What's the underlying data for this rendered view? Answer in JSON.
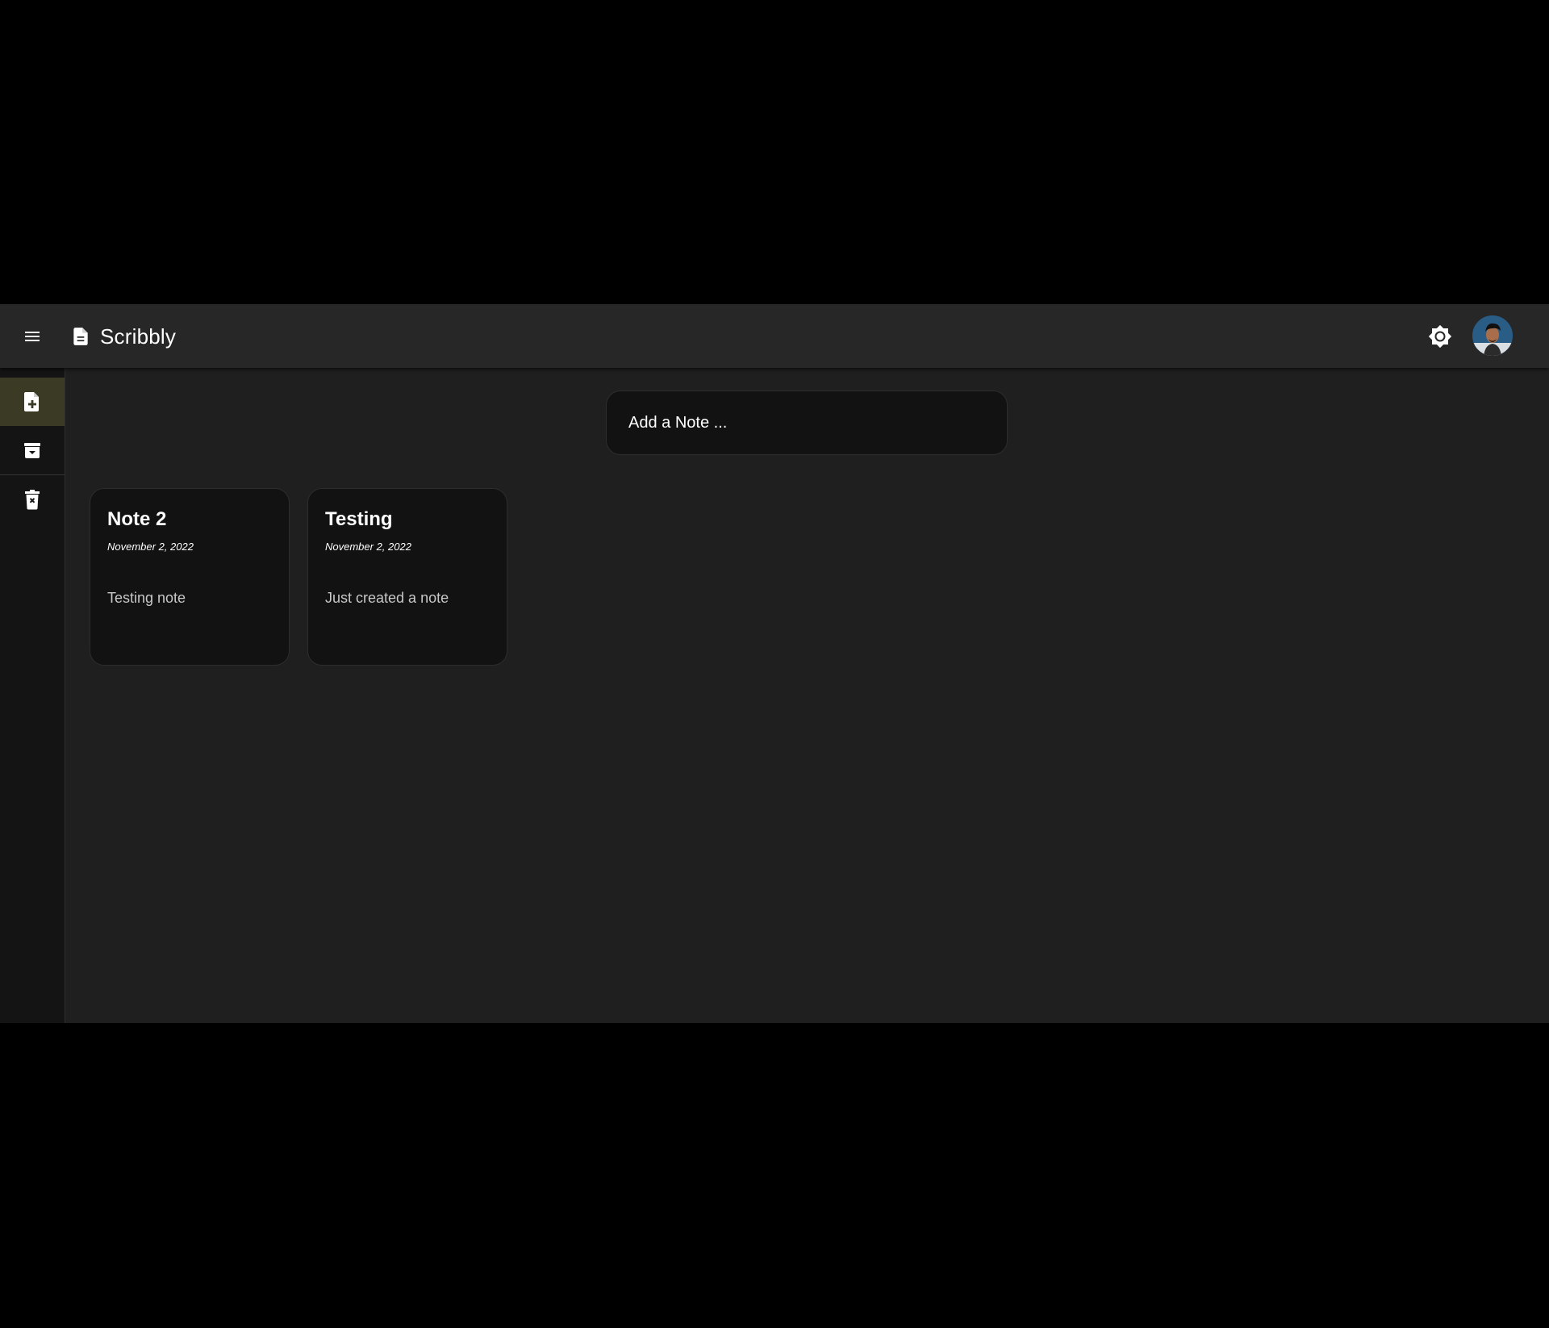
{
  "app": {
    "title": "Scribbly",
    "theme": "dark",
    "colors": {
      "background": "#1f1f1f",
      "appbar": "#272727",
      "sidebar": "#141414",
      "sidebar_active": "#3b3a25",
      "card": "#121212",
      "text": "#ffffff",
      "muted_text": "#c8c8c8"
    }
  },
  "header": {
    "menu_icon": "menu-icon",
    "brand_icon": "document-icon",
    "theme_toggle_icon": "brightness-icon",
    "avatar_icon": "user-avatar"
  },
  "sidebar": {
    "items": [
      {
        "icon": "note-add-icon",
        "active": true
      },
      {
        "icon": "archive-icon",
        "active": false
      },
      {
        "icon": "trash-icon",
        "active": false
      }
    ]
  },
  "add_note": {
    "placeholder": "Add a Note ..."
  },
  "notes": [
    {
      "title": "Note 2",
      "date": "November 2, 2022",
      "body": "Testing note"
    },
    {
      "title": "Testing",
      "date": "November 2, 2022",
      "body": "Just created a note"
    }
  ]
}
